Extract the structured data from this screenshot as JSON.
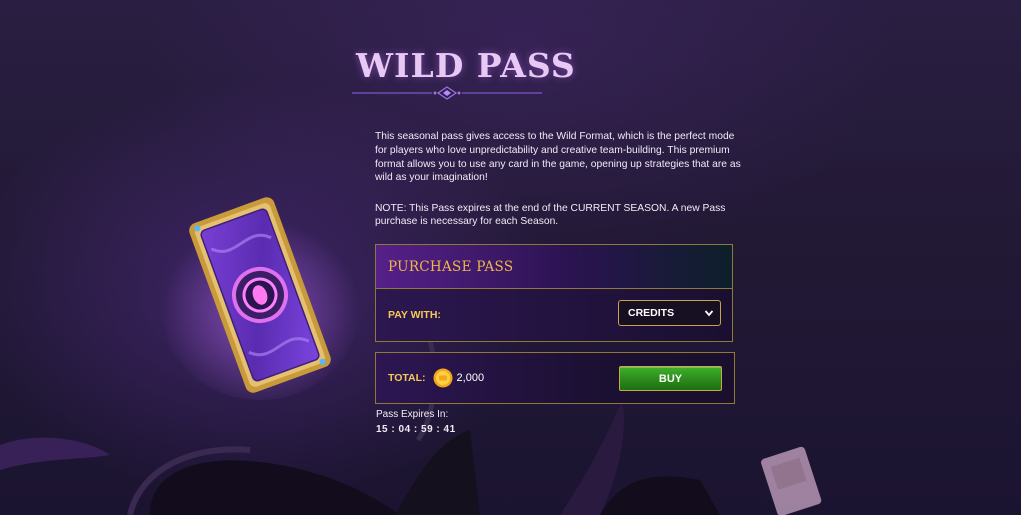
{
  "page": {
    "title": "WILD PASS",
    "description": "This seasonal pass gives access to the Wild Format, which is the perfect mode for players who love unpredictability and creative team-building. This premium format allows you to use any card in the game, opening up strategies that are as wild as your imagination!",
    "note": "NOTE: This Pass expires at the end of the CURRENT SEASON. A new Pass purchase is necessary for each Season."
  },
  "purchase": {
    "header": "PURCHASE PASS",
    "pay_with_label": "PAY WITH:",
    "pay_with_value": "CREDITS"
  },
  "total": {
    "label": "TOTAL:",
    "amount": "2,000",
    "buy_label": "BUY"
  },
  "expiry": {
    "label": "Pass Expires In:",
    "countdown": "15 : 04 : 59 : 41"
  },
  "colors": {
    "gold": "#f3c95a",
    "buy_green": "#3fb12a",
    "title_pink": "#e8c8f5",
    "border_gold": "#8c7a36"
  },
  "icons": [
    "ticket-icon",
    "credit-coin-icon",
    "chevron-down-icon"
  ]
}
